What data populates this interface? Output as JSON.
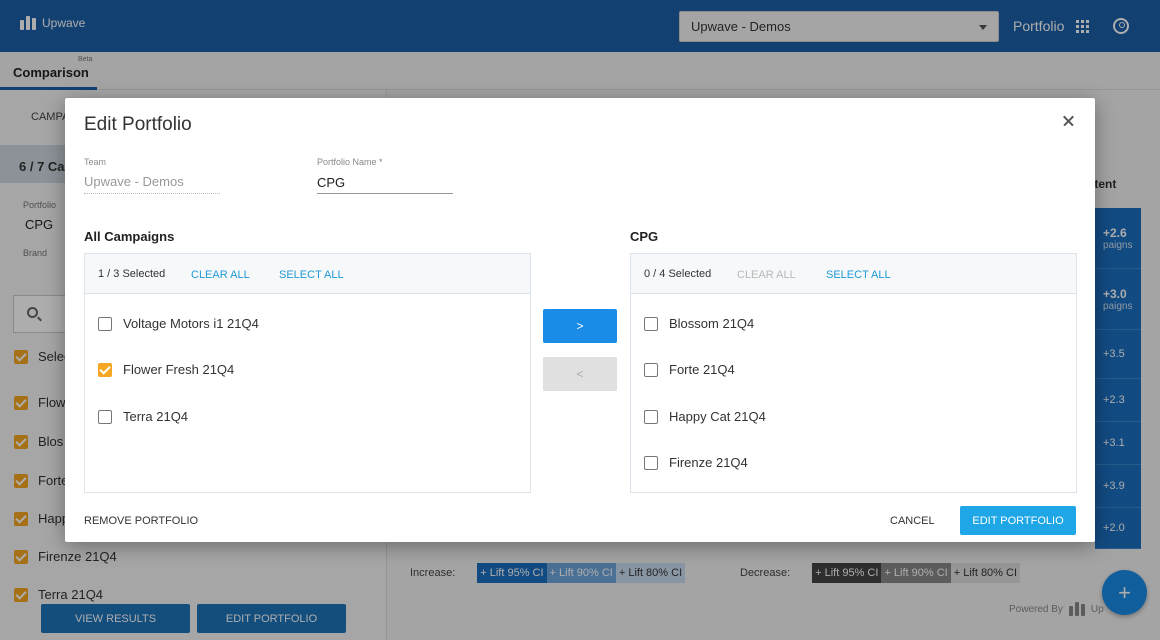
{
  "app": {
    "brand": "Upwave",
    "team_select": "Upwave - Demos",
    "portfolio_link": "Portfolio"
  },
  "subnav": {
    "tab": "Comparison",
    "beta": "Beta"
  },
  "left": {
    "campaigns_tab": "CAMPA",
    "count": "6 / 7 Ca",
    "portfolio_label": "Portfolio",
    "portfolio_value": "CPG",
    "brand_label": "Brand",
    "select_label": "Selec",
    "items": [
      "Flow",
      "Blos",
      "Forte",
      "Happ",
      "Firenze 21Q4",
      "Terra 21Q4"
    ],
    "view_results": "VIEW RESULTS",
    "edit_portfolio": "EDIT PORTFOLIO"
  },
  "right": {
    "column_header": "ntent",
    "lifts": [
      {
        "value": "+2.6",
        "sub": "paigns"
      },
      {
        "value": "+3.0",
        "sub": "paigns"
      },
      {
        "value": "+3.5",
        "sub": ""
      },
      {
        "value": "+2.3",
        "sub": ""
      },
      {
        "value": "+3.1",
        "sub": ""
      },
      {
        "value": "+3.9",
        "sub": ""
      },
      {
        "value": "+2.0",
        "sub": ""
      }
    ],
    "increase_label": "Increase:",
    "decrease_label": "Decrease:",
    "ci": [
      "+ Lift 95% CI",
      "+ Lift 90% CI",
      "+ Lift 80% CI"
    ],
    "powered_by": "Powered By",
    "powered_brand": "Up",
    "fab": "+"
  },
  "modal": {
    "title": "Edit Portfolio",
    "team_label": "Team",
    "team_value": "Upwave - Demos",
    "name_label": "Portfolio Name *",
    "name_value": "CPG",
    "all_title": "All Campaigns",
    "all_selected": "1 / 3 Selected",
    "cpg_title": "CPG",
    "cpg_selected": "0 / 4 Selected",
    "clear_all": "CLEAR ALL",
    "select_all": "SELECT ALL",
    "all_items": [
      "Voltage Motors i1 21Q4",
      "Flower Fresh 21Q4",
      "Terra 21Q4"
    ],
    "cpg_items": [
      "Blossom 21Q4",
      "Forte 21Q4",
      "Happy Cat 21Q4",
      "Firenze 21Q4"
    ],
    "move_right": ">",
    "move_left": "<",
    "remove": "REMOVE PORTFOLIO",
    "cancel": "CANCEL",
    "submit": "EDIT PORTFOLIO"
  },
  "colors": {
    "primary": "#1b5fa7",
    "accent": "#1ea6e6",
    "check": "#f5a623"
  }
}
